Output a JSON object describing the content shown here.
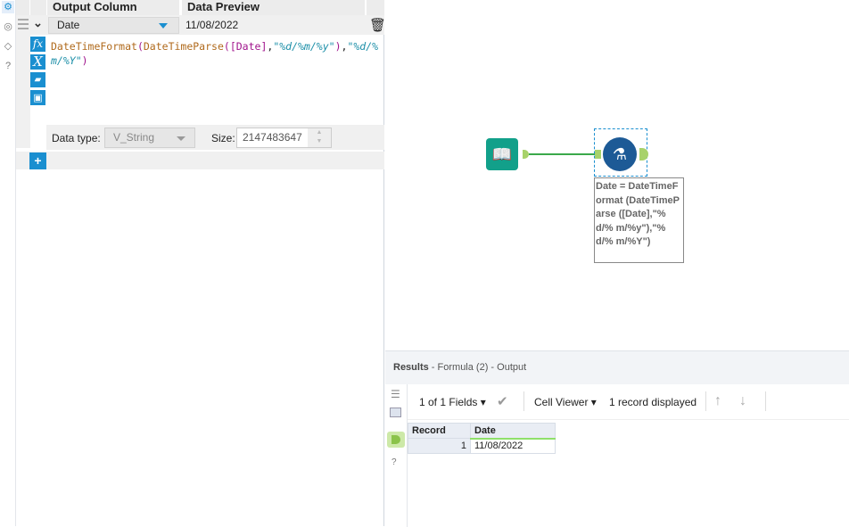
{
  "config": {
    "headers": {
      "output_column": "Output Column",
      "data_preview": "Data Preview"
    },
    "row": {
      "column": "Date",
      "preview": "11/08/2022"
    },
    "expression": {
      "fn1": "DateTimeFormat",
      "p1": "(",
      "fn2": "DateTimeParse",
      "p2": "(",
      "field": "[Date]",
      "c1": ",",
      "s1": "\"%d/%m/%y\"",
      "p3": ")",
      "c2": ",",
      "s2": "\"%d/%m/%Y\"",
      "p4": ")"
    },
    "data_type_label": "Data type:",
    "data_type": "V_String",
    "size_label": "Size:",
    "size": "2147483647",
    "add_label": "+"
  },
  "canvas": {
    "annotation": "Date = DateTimeFormat (DateTimeParse ([Date],\"%d/% m/%y\"),\"%d/% m/%Y\")"
  },
  "results": {
    "title": "Results",
    "subtitle": " - Formula (2) - Output",
    "fields": "1 of 1 Fields",
    "cell_viewer": "Cell Viewer",
    "records": "1 record displayed",
    "columns": [
      "Record",
      "Date"
    ],
    "rows": [
      {
        "record": "1",
        "date": "11/08/2022"
      }
    ]
  },
  "colors": {
    "accent": "#1a8fd0",
    "connection": "#3aa84a",
    "tool_green": "#12a08a",
    "formula_blue": "#1d5a96"
  }
}
